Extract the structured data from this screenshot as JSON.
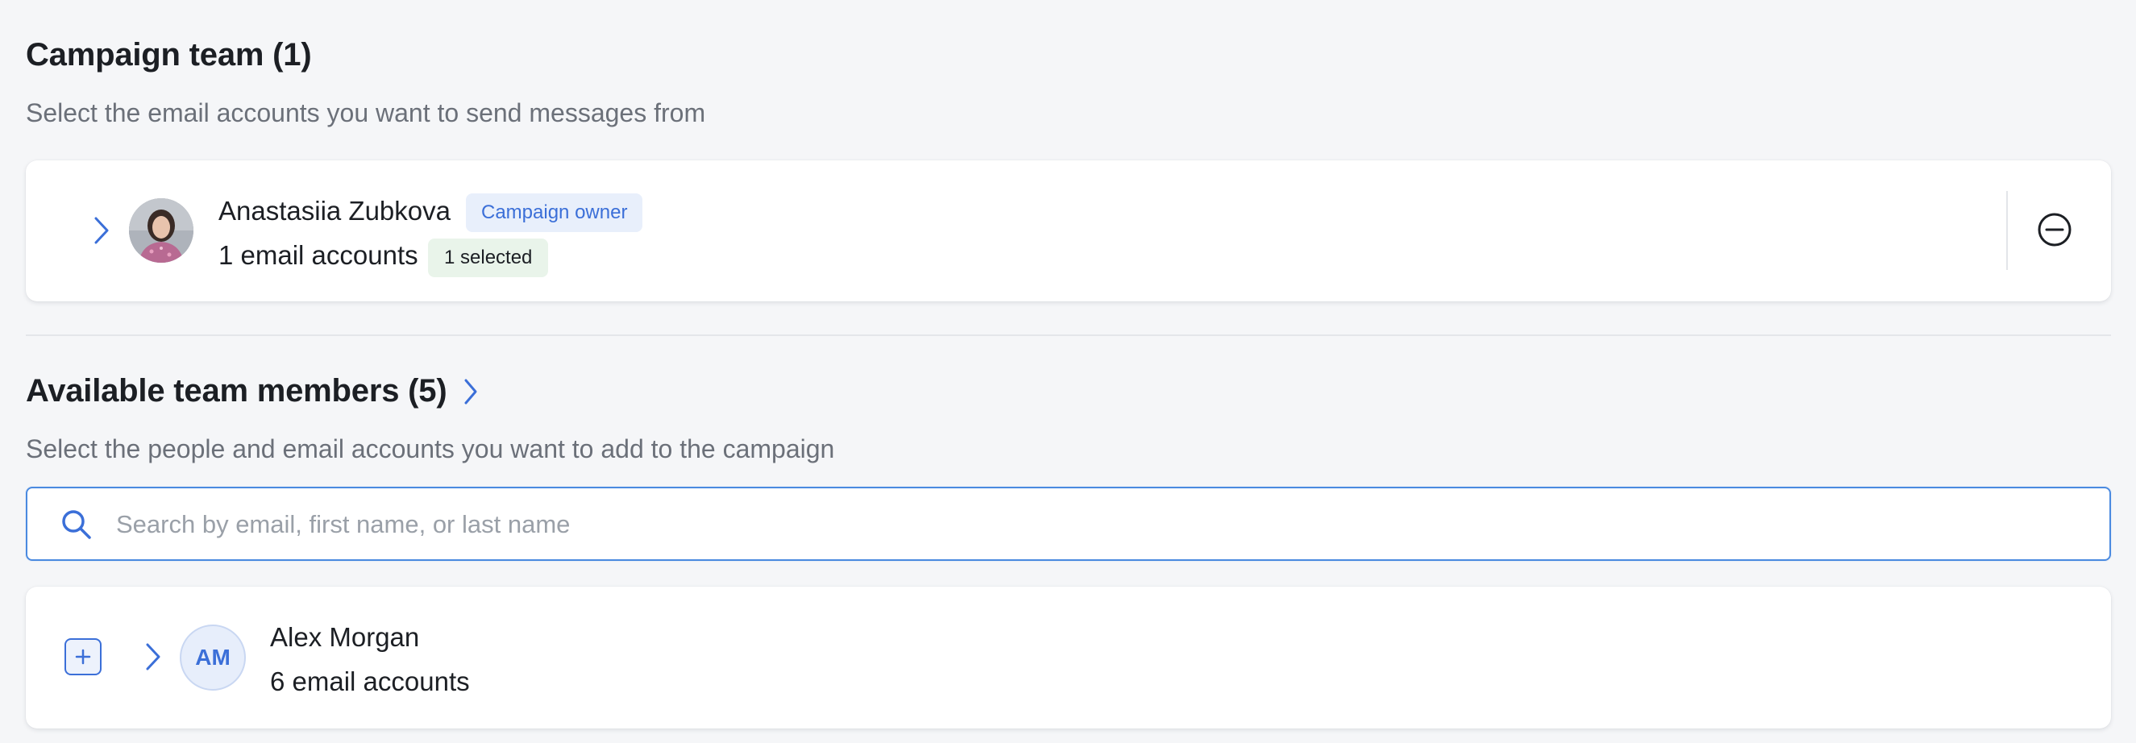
{
  "campaign_team": {
    "title": "Campaign team (1)",
    "subtitle": "Select the email accounts you want to send messages from",
    "members": [
      {
        "name": "Anastasiia Zubkova",
        "role_badge": "Campaign owner",
        "accounts_text": "1 email accounts",
        "selected_badge": "1 selected"
      }
    ]
  },
  "available": {
    "title": "Available team members (5)",
    "subtitle": "Select the people and email accounts you want to add to the campaign",
    "search": {
      "placeholder": "Search by email, first name, or last name",
      "value": ""
    },
    "members": [
      {
        "initials": "AM",
        "name": "Alex Morgan",
        "accounts_text": "6 email accounts"
      }
    ]
  },
  "colors": {
    "accent": "#3b6fd8",
    "background": "#f5f6f8",
    "owner_badge_bg": "#e8effb",
    "selected_badge_bg": "#e9f4ea"
  },
  "icons": {
    "expand": "chevron-right-icon",
    "remove": "minus-circle-icon",
    "search": "search-icon",
    "add": "plus-icon"
  }
}
